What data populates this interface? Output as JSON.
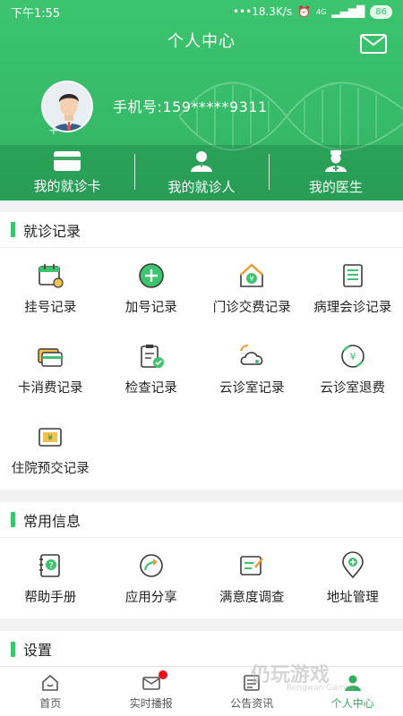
{
  "status": {
    "time": "下午1:55",
    "speed": "•••18.3K/s",
    "net": "4G",
    "battery": "86"
  },
  "header": {
    "title": "个人中心",
    "phone": "手机号:159*****9311"
  },
  "quick": [
    {
      "label": "我的就诊卡",
      "icon": "card-icon"
    },
    {
      "label": "我的就诊人",
      "icon": "person-icon"
    },
    {
      "label": "我的医生",
      "icon": "doctor-icon"
    }
  ],
  "visit": {
    "title": "就诊记录",
    "items": [
      "挂号记录",
      "加号记录",
      "门诊交费记录",
      "病理会诊记录",
      "卡消费记录",
      "检查记录",
      "云诊室记录",
      "云诊室退费",
      "住院预交记录"
    ]
  },
  "common": {
    "title": "常用信息",
    "items": [
      "帮助手册",
      "应用分享",
      "满意度调查",
      "地址管理"
    ]
  },
  "settings": {
    "title": "设置"
  },
  "tabs": [
    "首页",
    "实时播报",
    "公告资讯",
    "个人中心"
  ],
  "watermark": {
    "main": "仍玩游戏",
    "sub": "Rengwan Games"
  },
  "colors": {
    "brand": "#3cc46f",
    "badge": "#e8101d"
  }
}
